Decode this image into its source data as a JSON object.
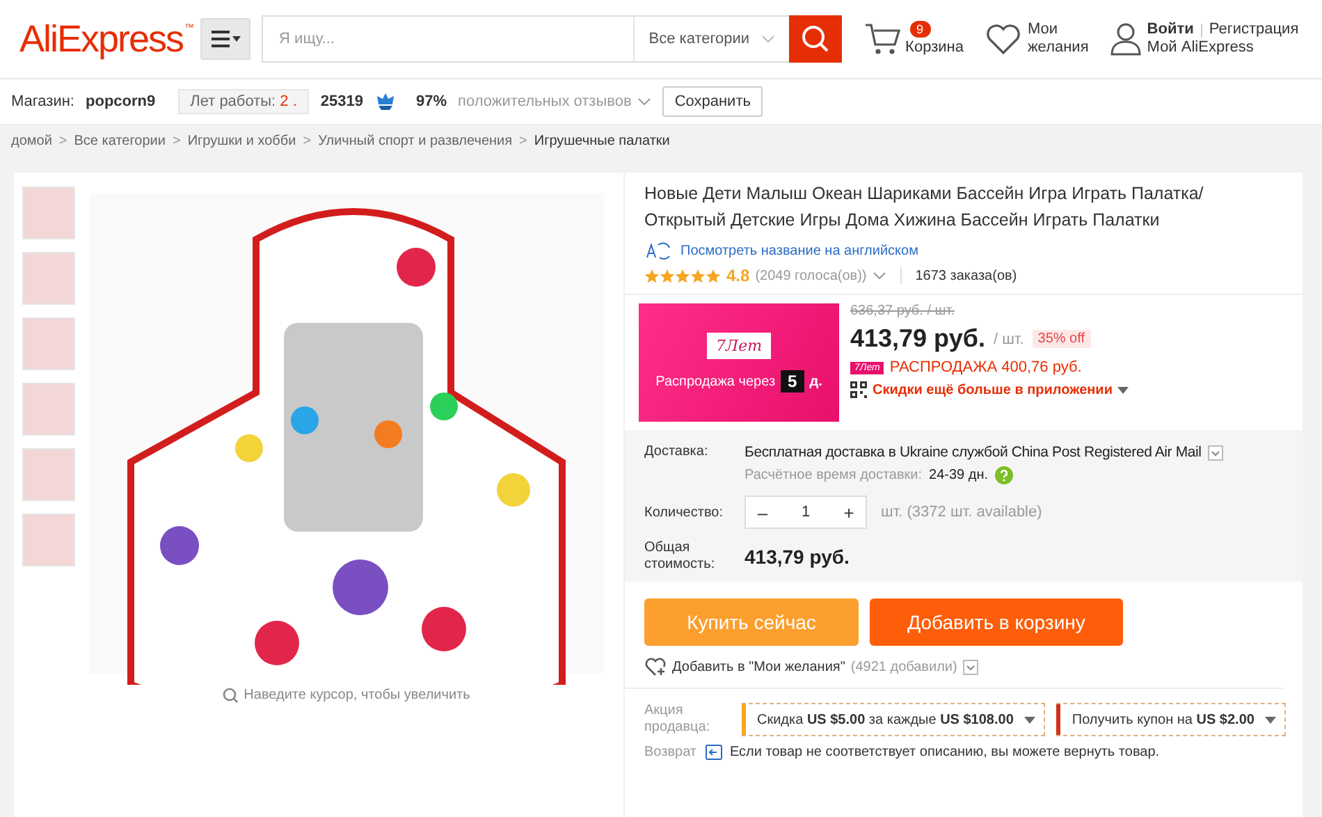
{
  "header": {
    "logo": "AliExpress",
    "logo_mark": "™",
    "search": {
      "placeholder": "Я ищу...",
      "category": "Все категории"
    },
    "cart": {
      "count": "9",
      "label": "Корзина"
    },
    "wishlist": {
      "line1": "Мои",
      "line2": "желания"
    },
    "account": {
      "login": "Войти",
      "register": "Регистрация",
      "my": "Мой AliExpress"
    }
  },
  "store_bar": {
    "label": "Магазин:",
    "name": "popcorn9",
    "years_label": "Лет работы:",
    "years": "2 .",
    "score": "25319",
    "positive": "97%",
    "positive_label": "положительных отзывов",
    "save": "Сохранить"
  },
  "breadcrumb_separator": ">",
  "breadcrumb": [
    "домой",
    "Все категории",
    "Игрушки и хобби",
    "Уличный спорт и развлечения",
    "Игрушечные палатки"
  ],
  "gallery": {
    "zoom_hint": "Наведите курсор, чтобы увеличить"
  },
  "product": {
    "title": "Новые Дети Малыш Океан Шариками Бассейн Игра Играть Палатка/ Открытый Детские Игры Дома Хижина Бассейн Играть Палатки",
    "translate": "Посмотреть название на английском",
    "stars": 5,
    "rating": "4.8",
    "votes": "(2049 голоса(ов))",
    "orders": "1673 заказа(ов)"
  },
  "promo": {
    "badge": "7Лет",
    "countdown_label": "Распродажа через",
    "days": "5",
    "days_unit": "д.",
    "old_price": "636,37 руб. / шт.",
    "price": "413,79 руб.",
    "unit": "/ шт.",
    "discount": "35% off",
    "sale_badge": "7Лет",
    "sale": "РАСПРОДАЖА 400,76 руб.",
    "app": "Скидки ещё больше в приложении"
  },
  "delivery": {
    "label": "Доставка:",
    "text": "Бесплатная доставка в Ukraine службой China Post Registered Air Mail",
    "time_label": "Расчётное время доставки:",
    "time": "24-39 дн."
  },
  "quantity": {
    "label": "Количество:",
    "minus": "–",
    "value": "1",
    "plus": "+",
    "available": "шт. (3372 шт. available)"
  },
  "total": {
    "label": "Общая стоимость:",
    "value": "413,79 руб."
  },
  "buttons": [
    {
      "kind": "buy",
      "label": "Купить сейчас"
    },
    {
      "kind": "cart",
      "label": "Добавить в корзину"
    }
  ],
  "wish": {
    "text": "Добавить в \"Мои желания\"",
    "count": "(4921 добавили)"
  },
  "seller_promo": {
    "label": "Акция продавца:",
    "coupons": [
      {
        "color": "#f5a623",
        "text": "Скидка **US $5.00** за каждые **US $108.00**"
      },
      {
        "color": "#d0321b",
        "text": "Получить купон на **US $2.00**"
      }
    ]
  },
  "returns": {
    "label": "Возврат",
    "text": "Если товар не соответствует описанию, вы можете вернуть товар."
  }
}
